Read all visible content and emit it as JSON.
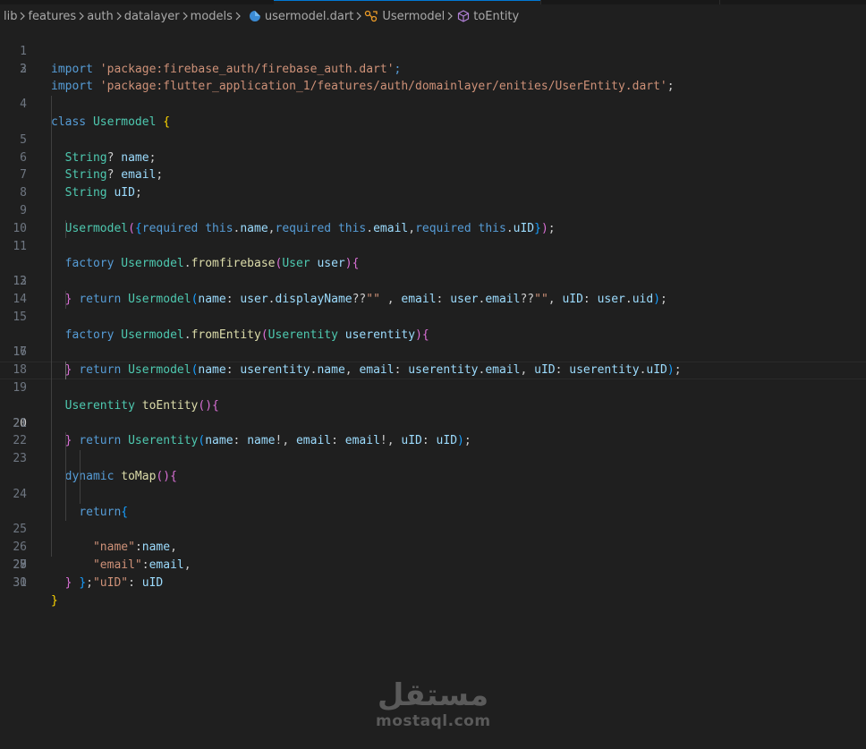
{
  "breadcrumb": {
    "items": [
      "lib",
      "features",
      "auth",
      "datalayer",
      "models",
      "usermodel.dart",
      "Usermodel",
      "toEntity"
    ],
    "file_icon": "dart-file-icon",
    "class_icon": "class-symbol-icon",
    "method_icon": "method-symbol-icon"
  },
  "editor": {
    "current_line": 20,
    "lines": [
      "import 'package:firebase_auth/firebase_auth.dart';",
      "import 'package:flutter_application_1/features/auth/domainlayer/enities/UserEntity.dart';",
      "",
      "class Usermodel {",
      "  String? name;",
      "  String? email;",
      "  String uID;",
      "",
      "  Usermodel({required this.name,required this.email,required this.uID});",
      "",
      "  factory Usermodel.fromfirebase(User user){",
      "    return Usermodel(name: user.displayName??\"\" , email: user.email??\"\", uID: user.uid);",
      "  }",
      "",
      "  factory Usermodel.fromEntity(Userentity userentity){",
      "    return Usermodel(name: userentity.name, email: userentity.email, uID: userentity.uID);",
      "  }",
      "",
      "  Userentity toEntity(){",
      "    return Userentity(name: name!, email: email!, uID: uID);",
      "  }",
      "",
      "  dynamic toMap(){",
      "    return{",
      "      \"name\":name,",
      "      \"email\":email,",
      "      \"uID\": uID",
      "    };",
      "  }",
      "",
      "}"
    ]
  },
  "watermark": {
    "arabic": "مستقل",
    "latin": "mostaql.com"
  },
  "colors": {
    "background": "#1f1f1f",
    "keyword": "#569cd6",
    "string": "#ce9178",
    "type": "#4ec9b0",
    "function": "#dcdcaa",
    "variable": "#9cdcfe",
    "bracket_1": "#ffd700",
    "bracket_2": "#da70d6",
    "bracket_3": "#179fff"
  }
}
